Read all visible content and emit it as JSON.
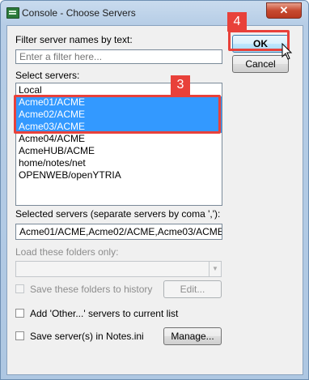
{
  "window": {
    "title": "Console - Choose Servers",
    "close_glyph": "✕"
  },
  "filter": {
    "label": "Filter server names by text:",
    "placeholder": "Enter a filter here..."
  },
  "buttons": {
    "ok": "OK",
    "cancel": "Cancel",
    "edit": "Edit...",
    "manage": "Manage..."
  },
  "servers": {
    "label": "Select servers:",
    "items": [
      {
        "label": "Local",
        "selected": false
      },
      {
        "label": "Acme01/ACME",
        "selected": true
      },
      {
        "label": "Acme02/ACME",
        "selected": true
      },
      {
        "label": "Acme03/ACME",
        "selected": true
      },
      {
        "label": "Acme04/ACME",
        "selected": false
      },
      {
        "label": "AcmeHUB/ACME",
        "selected": false
      },
      {
        "label": "home/notes/net",
        "selected": false
      },
      {
        "label": "OPENWEB/openYTRIA",
        "selected": false
      }
    ]
  },
  "selected_servers": {
    "label": "Selected servers (separate servers by coma ','):",
    "value": "Acme01/ACME,Acme02/ACME,Acme03/ACME"
  },
  "folders": {
    "label": "Load these folders only:",
    "save_history_label": "Save these folders to history"
  },
  "options": {
    "add_other_label": "Add 'Other...' servers to current list",
    "save_notes_ini_label": "Save server(s) in Notes.ini"
  },
  "annotations": {
    "step_ok": "4",
    "step_list": "3",
    "color": "#e8413a"
  },
  "colors": {
    "selection": "#3399ff",
    "title_bar": "#c9dbee"
  }
}
